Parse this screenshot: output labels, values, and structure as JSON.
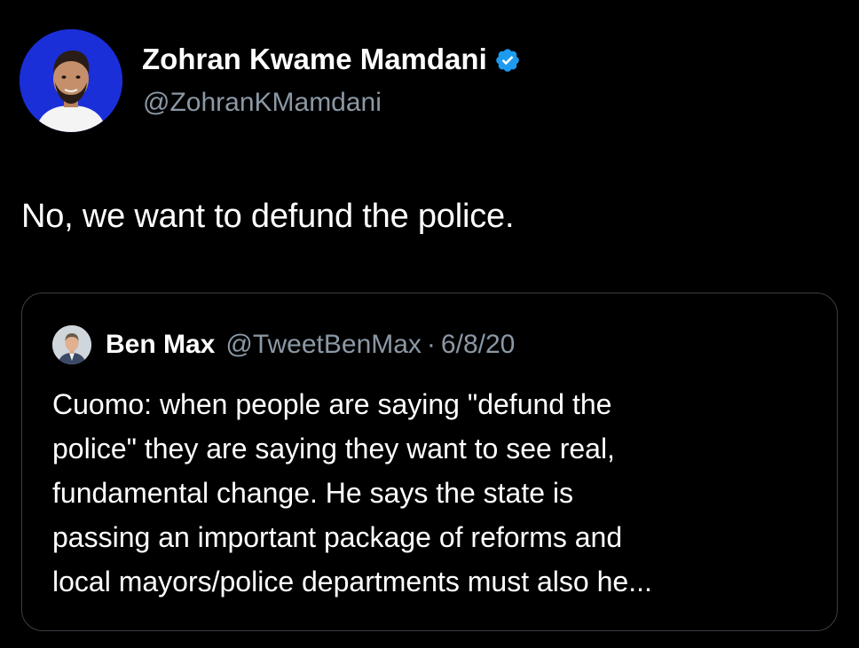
{
  "author": {
    "name": "Zohran Kwame Mamdani",
    "handle": "@ZohranKMamdani",
    "avatar_icon": "person-avatar-icon",
    "verified_icon": "verified-badge-icon",
    "verified_color": "#1d9bf0"
  },
  "tweet": {
    "text": "No, we want to defund the police."
  },
  "quote": {
    "author_name": "Ben Max",
    "author_handle": "@TweetBenMax",
    "separator": "·",
    "date": "6/8/20",
    "avatar_icon": "person-avatar-icon",
    "lines": [
      "Cuomo: when people are saying \"defund the",
      "police\" they are saying they want to see real,",
      "fundamental change. He says the state is",
      "passing an important package of reforms and",
      "local mayors/police departments must also he..."
    ]
  },
  "colors": {
    "background": "#000000",
    "primary_text": "#ffffff",
    "secondary_text": "#8b98a5",
    "avatar_background": "#1a2fd8",
    "card_border": "#3a3f44"
  }
}
